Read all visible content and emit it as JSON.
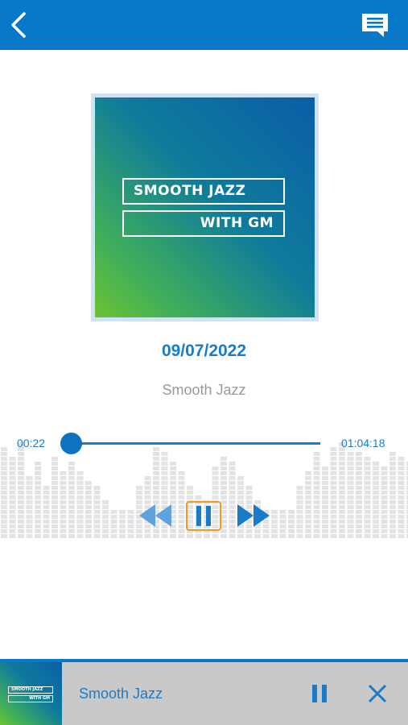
{
  "header": {
    "back_icon": "chevron-left-icon",
    "chat_icon": "chat-bubble-icon",
    "bar_color": "#0a78c8"
  },
  "cover": {
    "line1": "SMOOTH JAZZ",
    "line2": "WITH GM"
  },
  "episode": {
    "date": "09/07/2022",
    "show": "Smooth Jazz"
  },
  "player": {
    "elapsed": "00:22",
    "duration": "01:04:18",
    "progress_fraction": 0.005,
    "accent_color": "#1a7cc9",
    "focus_color": "#f09a22"
  },
  "controls": {
    "rewind_icon": "rewind-icon",
    "pause_icon": "pause-icon",
    "forward_icon": "fast-forward-icon"
  },
  "mini_player": {
    "title": "Smooth Jazz",
    "thumb_line1": "SMOOTH JAZZ",
    "thumb_line2": "WITH GM",
    "pause_icon": "pause-icon",
    "close_icon": "close-icon"
  }
}
